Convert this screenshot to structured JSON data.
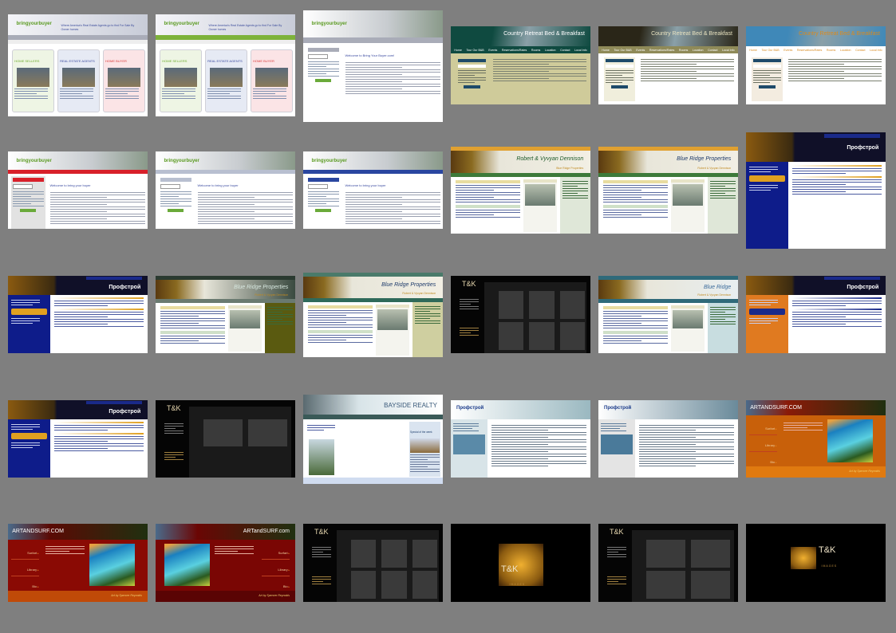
{
  "thumbnails": [
    {
      "type": "byb_a",
      "logo": "bringyourbuyer",
      "tagline": "Where America's Real Estate Agents go to find For Sale By Owner homes",
      "panels": [
        "HOME SELLERS",
        "REAL ESTATE AGENTS",
        "HOME BUYER"
      ],
      "nav_color": "#a9acb8"
    },
    {
      "type": "byb_a",
      "logo": "bringyourbuyer",
      "tagline": "Where America's Real Estate Agents go to find For Sale By Owner homes",
      "panels": [
        "HOME SELLERS",
        "REAL ESTATE AGENTS",
        "HOME BUYER"
      ],
      "nav_color": "#7db23a"
    },
    {
      "type": "byb_b",
      "logo": "bringyourbuyer",
      "heading": "Welcome to Bring Your Buyer.com!",
      "nav_color": "#a9acb8",
      "side_color": "#ffffff"
    },
    {
      "type": "bnb",
      "title": "Country Retreat Bed & Breakfast",
      "nav": [
        "Home",
        "Tour Our B&B",
        "Events",
        "Reservations/Rates",
        "Rooms",
        "Location",
        "Contact",
        "Local Info"
      ],
      "colors": {
        "head": "#0f4a40",
        "nav": "#0f4a40",
        "body": "#cfcb9a",
        "side": "#cfcb9a",
        "title": "#ffffff"
      }
    },
    {
      "type": "bnb",
      "title": "Country Retreat Bed & Breakfast",
      "nav": [
        "Home",
        "Tour Our B&B",
        "Events",
        "Reservations/Rates",
        "Rooms",
        "Location",
        "Contact",
        "Local Info"
      ],
      "colors": {
        "head": "#2a2618",
        "nav": "#8f8a58",
        "body": "#ffffff",
        "side": "#f0eedc",
        "title": "#e8e2c0"
      }
    },
    {
      "type": "bnb",
      "title": "Country Retreat Bed & Breakfast",
      "nav": [
        "Home",
        "Tour Our B&B",
        "Events",
        "Reservations/Rates",
        "Rooms",
        "Location",
        "Contact",
        "Local Info"
      ],
      "colors": {
        "head": "#3f88b8",
        "nav": "#ffffff",
        "body": "#ffffff",
        "side": "#f3ece0",
        "title": "#d88a20"
      }
    },
    {
      "type": "byb_b",
      "logo": "bringyourbuyer",
      "heading": "Welcome to bring your buyer",
      "nav_color": "#d8202a",
      "side_color": "#e2e2e2"
    },
    {
      "type": "byb_b",
      "logo": "bringyourbuyer",
      "heading": "Welcome to bring your buyer",
      "nav_color": "#b8bfd0",
      "side_color": "#ffffff"
    },
    {
      "type": "byb_b",
      "logo": "bringyourbuyer",
      "heading": "Welcome to bring your buyer",
      "nav_color": "#2a46a0",
      "side_color": "#ffffff"
    },
    {
      "type": "bridge",
      "title": "Robert & Vyvyan Dennison",
      "sub": "Blue Ridge Properties",
      "colors": {
        "head": "#f2efe4",
        "nav": "#3d7a3a",
        "side": "#dfe7d8",
        "top": "#e0a030",
        "title": "#1d5a2a"
      }
    },
    {
      "type": "bridge",
      "title": "Blue Ridge Properties",
      "sub": "Robert & Vyvyan Dennison",
      "colors": {
        "head": "#f2efe4",
        "nav": "#3d7a3a",
        "side": "#dfe7d8",
        "top": "#e0a030",
        "title": "#1d3a6a"
      }
    },
    {
      "type": "prof",
      "logo": "Профстрой",
      "colors": {
        "side": "#0e1c8a",
        "accent": "#e0a020",
        "body": "#ffffff"
      }
    },
    {
      "type": "prof",
      "logo": "Профстрой",
      "colors": {
        "side": "#0e1c8a",
        "accent": "#e0a020",
        "body": "#ffffff"
      }
    },
    {
      "type": "bridge",
      "title": "Blue Ridge Properties",
      "sub": "Robert & Vyvyan Dennison",
      "colors": {
        "head": "#3a4a40",
        "nav": "#6a7a70",
        "side": "#5a5a10",
        "top": "#2a3a30",
        "title": "#d8e8e0"
      }
    },
    {
      "type": "bridge",
      "title": "Blue Ridge Properties",
      "sub": "Robert & Vyvyan Dennison",
      "colors": {
        "head": "#f2efe4",
        "nav": "#2f6a5a",
        "side": "#cfcfa0",
        "top": "#4a7a6a",
        "title": "#1d3a6a"
      }
    },
    {
      "type": "tk",
      "logo": "T&K",
      "boxes": 6
    },
    {
      "type": "bridge",
      "title": "Blue Ridge",
      "sub": "Robert & Vyvyan Dennison",
      "colors": {
        "head": "#e8eef0",
        "nav": "#2f6a7a",
        "side": "#c8dde0",
        "top": "#2f6a7a",
        "title": "#3a6a9a"
      }
    },
    {
      "type": "prof",
      "logo": "Профстрой",
      "colors": {
        "side": "#e07a20",
        "accent": "#1a2a8a",
        "body": "#ffffff"
      }
    },
    {
      "type": "prof",
      "logo": "Профстрой",
      "colors": {
        "side": "#0e1c8a",
        "accent": "#e0a020",
        "body": "#ffffff"
      }
    },
    {
      "type": "tk",
      "logo": "T&K",
      "boxes": 2
    },
    {
      "type": "bayside",
      "title": "BAYSIDE REALTY",
      "feature": "Special of the week",
      "footer": "Bayside Realty is licensed by the California Department of Real Estate"
    },
    {
      "type": "prof_light",
      "logo": "Профстрой",
      "colors": {
        "head": "#9ab8c0",
        "side": "#d8e4e8",
        "accent": "#5a8aa8",
        "body": "#ffffff"
      }
    },
    {
      "type": "prof_light",
      "logo": "Профстрой",
      "colors": {
        "head": "#6a8a9a",
        "side": "#e4e4e4",
        "accent": "#4a7a9a",
        "body": "#ffffff"
      }
    },
    {
      "type": "surf",
      "title": "ARTANDSURF.COM",
      "menu": [
        "Surfart",
        "Library",
        "Bio",
        "Contact",
        "Links"
      ],
      "signature": "Art by Spencer Reynolds",
      "colors": {
        "bg": "#c8600a",
        "head": "#8a1a08",
        "band": "#e07a10"
      }
    },
    {
      "type": "surf",
      "title": "ARTANDSURF.COM",
      "menu": [
        "Surfart",
        "Library",
        "Bio",
        "Contact",
        "Links"
      ],
      "signature": "Art by Spencer Reynolds",
      "colors": {
        "bg": "#8a0a04",
        "head": "#5a0a04",
        "band": "#c04a08"
      }
    },
    {
      "type": "surf",
      "title": "ARTandSURF.com",
      "menu": [
        "Surfart",
        "Library",
        "Bio",
        "Contact",
        "Links"
      ],
      "signature": "Art by Spencer Reynolds",
      "colors": {
        "bg": "#7a0604",
        "head": "#6a0604",
        "band": "#5a0404"
      },
      "menu_right": true
    },
    {
      "type": "tk",
      "logo": "T&K",
      "boxes": 6,
      "side_left": true
    },
    {
      "type": "tkimg",
      "logo": "T&K",
      "sub": "IMAGES"
    },
    {
      "type": "tk",
      "logo": "T&K",
      "boxes": 4
    },
    {
      "type": "tkimg",
      "logo": "T&K",
      "sub": "IMAGES",
      "wide": true
    }
  ]
}
